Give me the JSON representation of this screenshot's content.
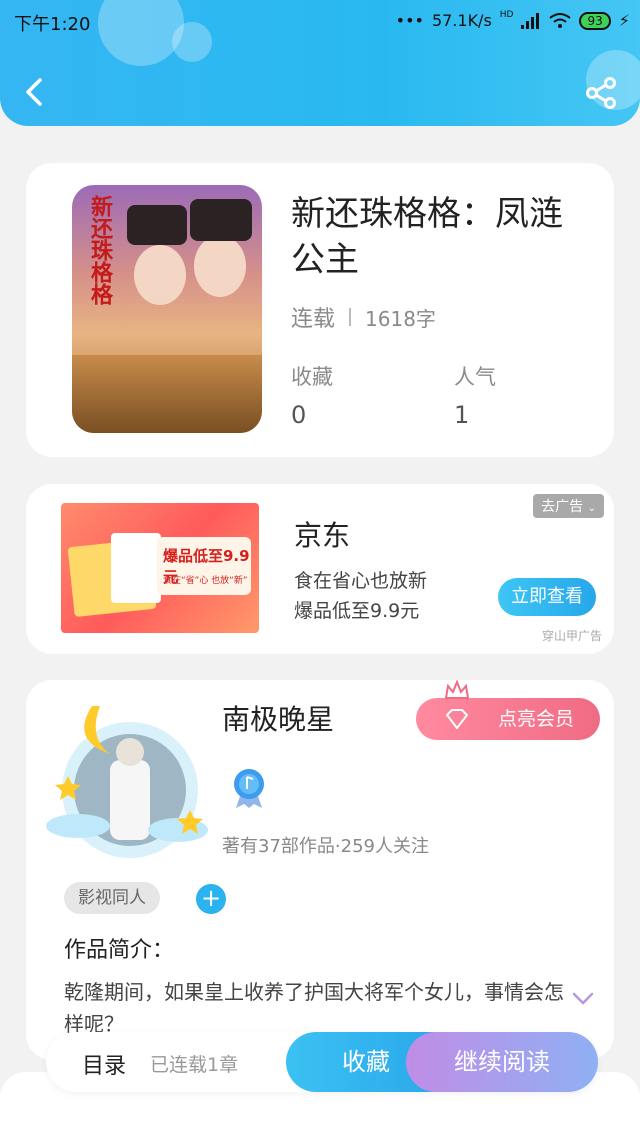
{
  "status_bar": {
    "time": "下午1:20",
    "network_speed": "57.1K/s",
    "signal_badge": "HD",
    "battery": "93"
  },
  "header": {
    "back_icon": "chevron-left-icon",
    "share_icon": "share-icon"
  },
  "book": {
    "cover_art_text": "新还珠格格",
    "title": "新还珠格格：凤涟公主",
    "status": "连载",
    "word_count": "1618字",
    "favorites_label": "收藏",
    "favorites_value": "0",
    "popularity_label": "人气",
    "popularity_value": "1"
  },
  "ad": {
    "advertiser": "京东",
    "line1": "食在省心也放新",
    "line2": "爆品低至9.9元",
    "close_label": "去广告",
    "cta": "立即查看",
    "source": "穿山甲广告",
    "banner_main": "爆品低至9.9元",
    "banner_sub": "食在“省”心 也放“新”"
  },
  "author": {
    "name": "南极晚星",
    "vip_label": "点亮会员",
    "stats": "著有37部作品·259人关注",
    "tag": "影视同人",
    "intro_label": "作品简介：",
    "intro_text": "乾隆期间，如果皇上收养了护国大将军个女儿，事情会怎样呢？"
  },
  "bottom": {
    "toc_label": "目录",
    "toc_status": "已连载1章",
    "favorite_btn": "收藏",
    "read_btn": "继续阅读"
  },
  "colors": {
    "header_blue": "#29b9f0",
    "accent_blue": "#2aa7ea",
    "vip_pink": "#f06b84",
    "read_purple": "#c08de6"
  }
}
